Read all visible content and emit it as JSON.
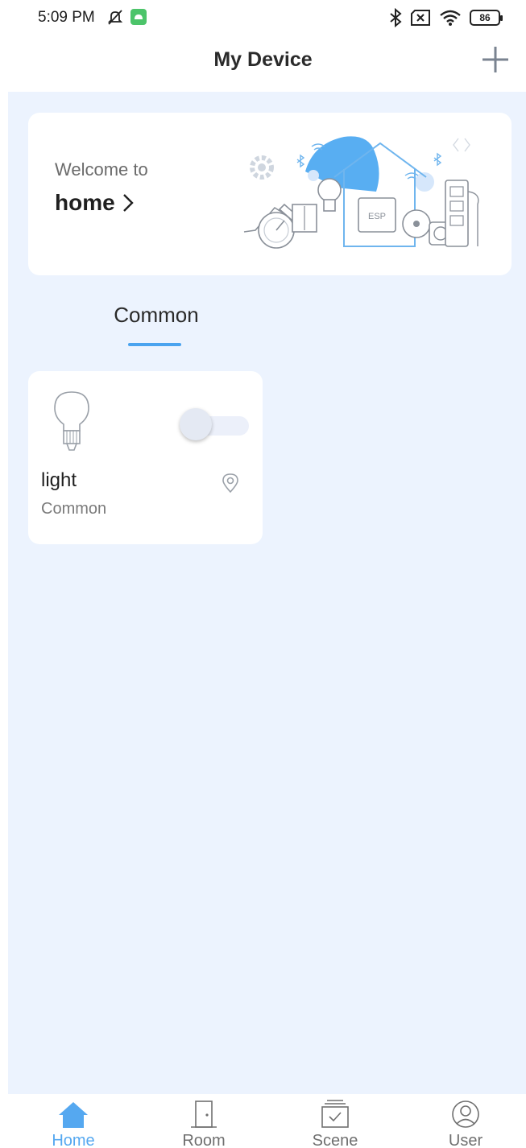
{
  "status_bar": {
    "time": "5:09 PM",
    "battery": "86",
    "icons": [
      "mute-notification-icon",
      "android-app-icon",
      "bluetooth-icon",
      "no-sim-icon",
      "wifi-icon",
      "battery-icon"
    ]
  },
  "header": {
    "title": "My Device",
    "add_icon": "plus-icon"
  },
  "welcome": {
    "line1": "Welcome to",
    "home": "home",
    "chevron": "chevron-right-icon",
    "illustration_label": "ESP"
  },
  "tabs": [
    {
      "label": "Common",
      "active": true
    }
  ],
  "devices": [
    {
      "name": "light",
      "room": "Common",
      "icon": "light-bulb-icon",
      "power_on": false
    }
  ],
  "nav": {
    "items": [
      {
        "label": "Home",
        "icon": "home-icon",
        "active": true
      },
      {
        "label": "Room",
        "icon": "door-icon",
        "active": false
      },
      {
        "label": "Scene",
        "icon": "scene-icon",
        "active": false
      },
      {
        "label": "User",
        "icon": "user-icon",
        "active": false
      }
    ]
  },
  "colors": {
    "accent": "#4aa3ef",
    "page_bg": "#ecf3fe",
    "card_bg": "#ffffff"
  }
}
